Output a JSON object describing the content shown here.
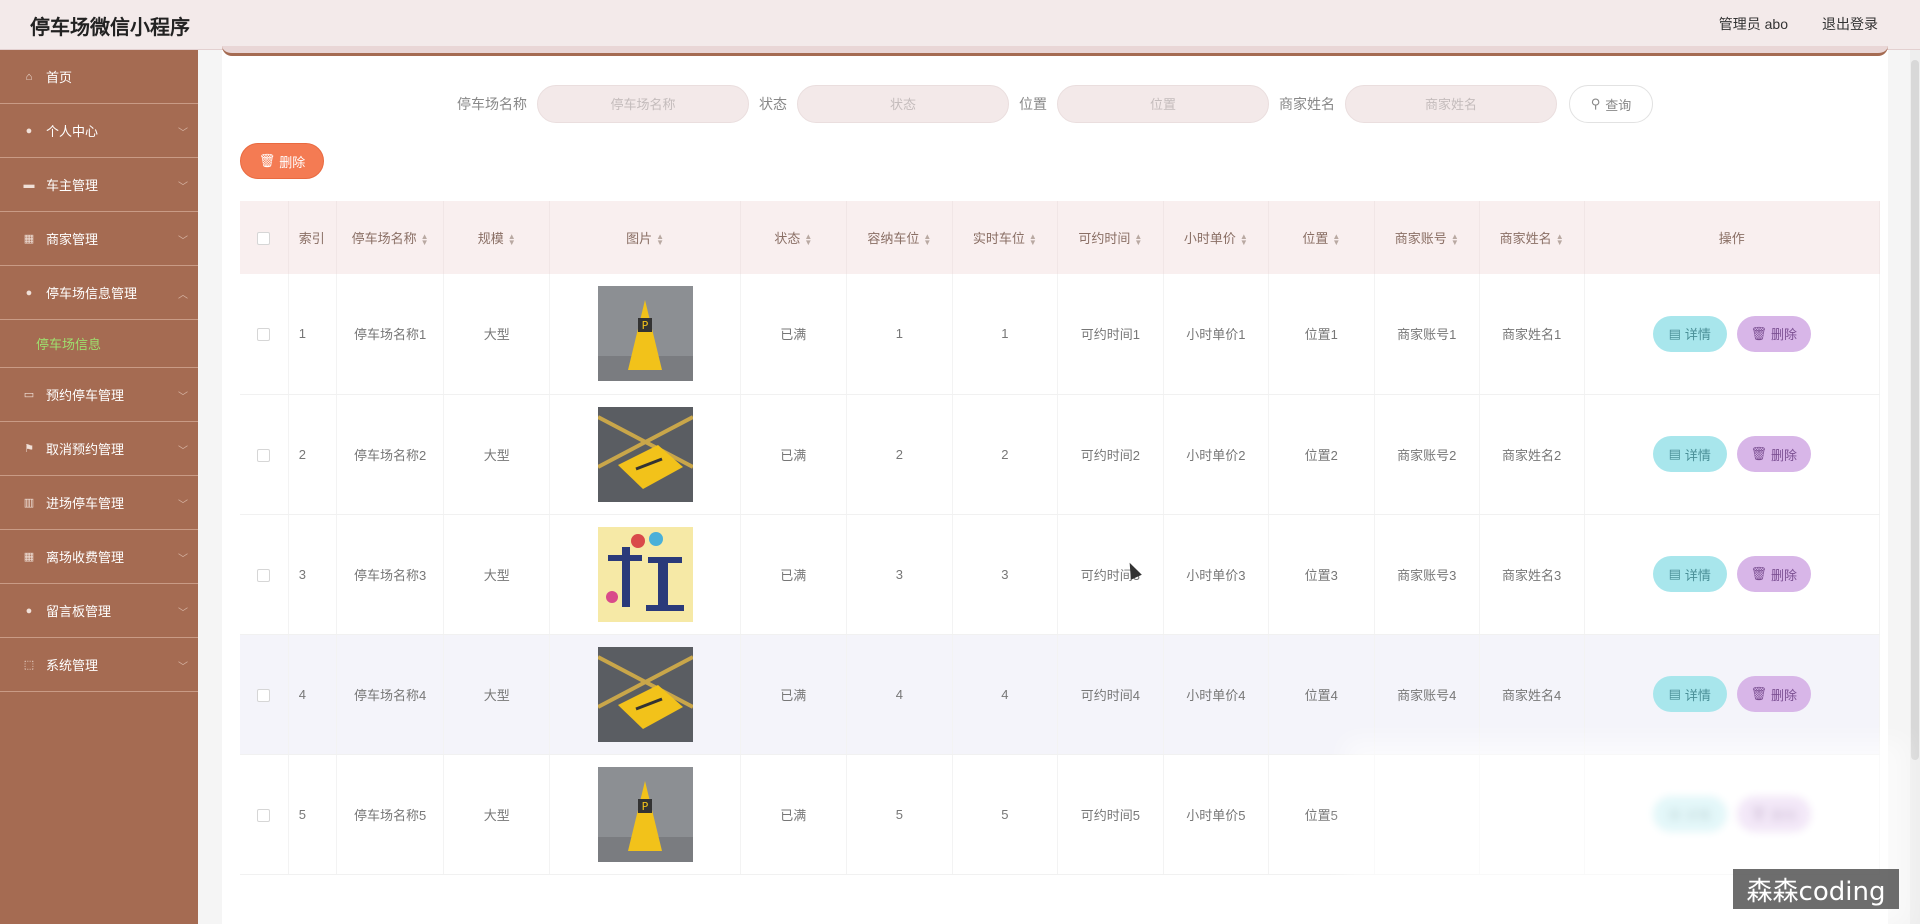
{
  "header": {
    "app_title": "停车场微信小程序",
    "admin_label": "管理员 abo",
    "logout_label": "退出登录"
  },
  "sidebar": {
    "items": [
      {
        "label": "首页",
        "icon": "home-icon",
        "chevron": false
      },
      {
        "label": "个人中心",
        "icon": "user-icon",
        "chevron": true
      },
      {
        "label": "车主管理",
        "icon": "car-icon",
        "chevron": true
      },
      {
        "label": "商家管理",
        "icon": "shop-icon",
        "chevron": true
      },
      {
        "label": "停车场信息管理",
        "icon": "user-icon",
        "chevron": true,
        "submenu": "停车场信息"
      },
      {
        "label": "预约停车管理",
        "icon": "card-icon",
        "chevron": true
      },
      {
        "label": "取消预约管理",
        "icon": "flag-icon",
        "chevron": true
      },
      {
        "label": "进场停车管理",
        "icon": "building-icon",
        "chevron": true
      },
      {
        "label": "离场收费管理",
        "icon": "grid-icon",
        "chevron": true
      },
      {
        "label": "留言板管理",
        "icon": "user-icon",
        "chevron": true
      },
      {
        "label": "系统管理",
        "icon": "square-icon",
        "chevron": true
      }
    ]
  },
  "search": {
    "fields": [
      {
        "label": "停车场名称",
        "placeholder": "停车场名称"
      },
      {
        "label": "状态",
        "placeholder": "状态"
      },
      {
        "label": "位置",
        "placeholder": "位置"
      },
      {
        "label": "商家姓名",
        "placeholder": "商家姓名"
      }
    ],
    "button_label": "查询"
  },
  "toolbar": {
    "delete_label": "删除"
  },
  "table": {
    "headers": [
      "索引",
      "停车场名称",
      "规模",
      "图片",
      "状态",
      "容纳车位",
      "实时车位",
      "可约时间",
      "小时单价",
      "位置",
      "商家账号",
      "商家姓名",
      "操作"
    ],
    "rows": [
      {
        "index": "1",
        "name": "停车场名称1",
        "scale": "大型",
        "image": "yellow-sign",
        "status": "已满",
        "capacity": "1",
        "realtime": "1",
        "time": "可约时间1",
        "price": "小时单价1",
        "location": "位置1",
        "account": "商家账号1",
        "merchant": "商家姓名1"
      },
      {
        "index": "2",
        "name": "停车场名称2",
        "scale": "大型",
        "image": "floor-sign",
        "status": "已满",
        "capacity": "2",
        "realtime": "2",
        "time": "可约时间2",
        "price": "小时单价2",
        "location": "位置2",
        "account": "商家账号2",
        "merchant": "商家姓名2"
      },
      {
        "index": "3",
        "name": "停车场名称3",
        "scale": "大型",
        "image": "car-slot",
        "status": "已满",
        "capacity": "3",
        "realtime": "3",
        "time": "可约时间3",
        "price": "小时单价3",
        "location": "位置3",
        "account": "商家账号3",
        "merchant": "商家姓名3"
      },
      {
        "index": "4",
        "name": "停车场名称4",
        "scale": "大型",
        "image": "floor-sign",
        "status": "已满",
        "capacity": "4",
        "realtime": "4",
        "time": "可约时间4",
        "price": "小时单价4",
        "location": "位置4",
        "account": "商家账号4",
        "merchant": "商家姓名4"
      },
      {
        "index": "5",
        "name": "停车场名称5",
        "scale": "大型",
        "image": "yellow-sign",
        "status": "已满",
        "capacity": "5",
        "realtime": "5",
        "time": "可约时间5",
        "price": "小时单价5",
        "location": "位置5",
        "account": "",
        "merchant": ""
      }
    ],
    "detail_label": "详情",
    "remove_label": "删除"
  },
  "watermark": "森森coding",
  "colors": {
    "sidebar": "#a56b52",
    "accent": "#f47b53",
    "active_submenu": "#9ee06e",
    "detail": "#a8e6ec",
    "remove": "#d8b6e8"
  }
}
